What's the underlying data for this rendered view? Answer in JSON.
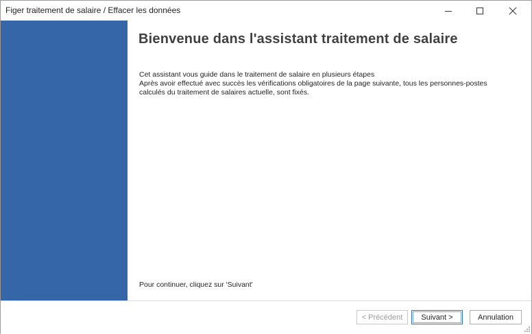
{
  "window": {
    "title": "Figer traitement de salaire / Effacer les données"
  },
  "title_buttons": {
    "minimize_icon": "minimize-icon",
    "maximize_icon": "maximize-icon",
    "close_icon": "close-icon"
  },
  "colors": {
    "sidebar": "#3566a8",
    "heading": "#404040",
    "default_button_border": "#2f6fd0"
  },
  "main": {
    "heading": "Bienvenue dans l'assistant traitement de salaire",
    "description_lines": [
      "Cet assistant vous guide dans le traitement de salaire en plusieurs étapes",
      "Après avoir effectué avec succès les vérifications obligatoires de la page suivante, tous les personnes-postes",
      "calculés du traitement de salaires actuelle, sont fixés."
    ],
    "continue_text": "Pour continuer, cliquez sur 'Suivant'"
  },
  "footer": {
    "prev_label": "< Précédent",
    "next_label": "Suivant >",
    "cancel_label": "Annulation"
  }
}
